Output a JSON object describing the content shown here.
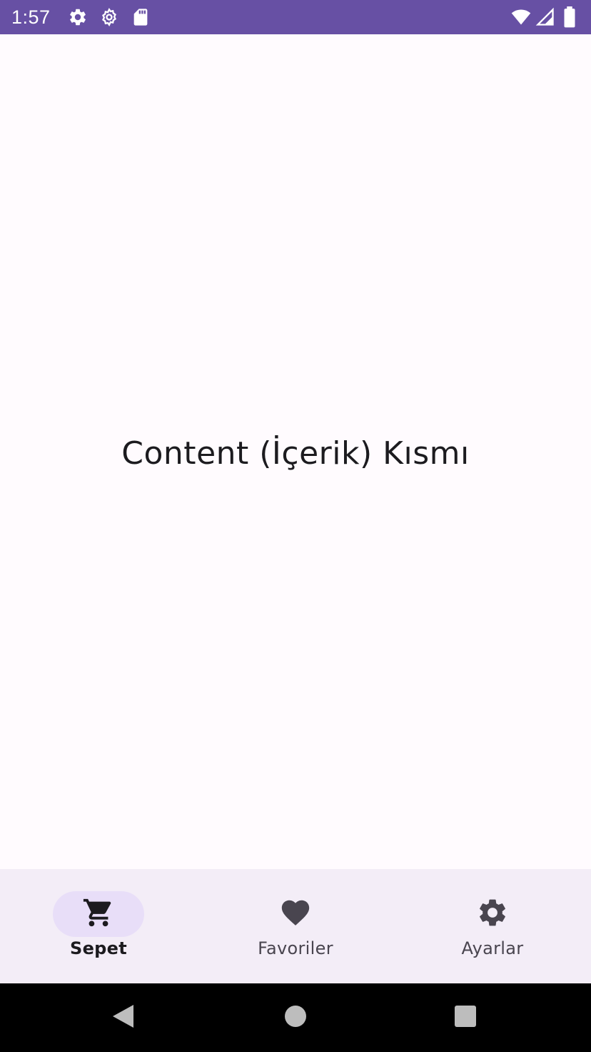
{
  "status_bar": {
    "time": "1:57",
    "icons_left": [
      "gear-icon",
      "settings-icon",
      "sd-card-icon"
    ],
    "icons_right": [
      "wifi-icon",
      "cell-signal-icon",
      "battery-icon"
    ],
    "background": "#6750a4"
  },
  "content": {
    "title": "Content (İçerik) Kısmı"
  },
  "bottom_nav": {
    "items": [
      {
        "label": "Sepet",
        "icon": "cart-icon",
        "active": true
      },
      {
        "label": "Favoriler",
        "icon": "heart-icon",
        "active": false
      },
      {
        "label": "Ayarlar",
        "icon": "gear-icon",
        "active": false
      }
    ],
    "background": "#f3edf7",
    "indicator_color": "#e8def8"
  },
  "system_nav": {
    "buttons": [
      "back-icon",
      "home-icon",
      "recents-icon"
    ]
  }
}
